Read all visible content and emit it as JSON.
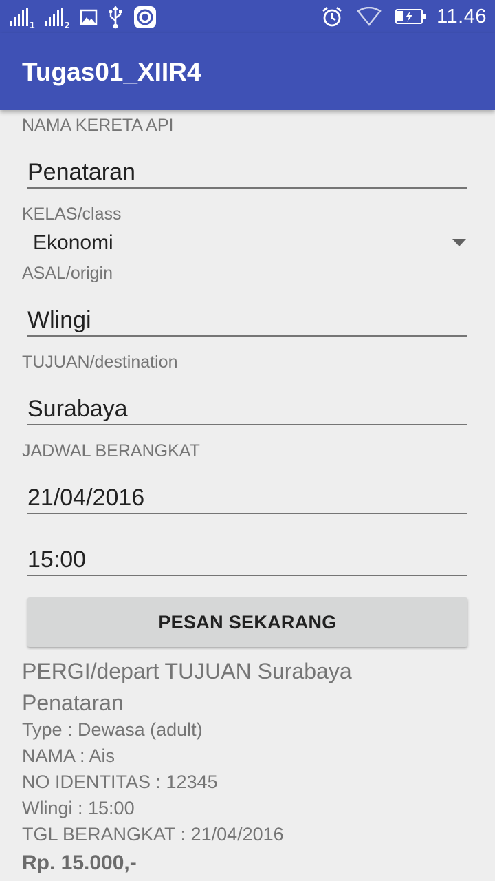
{
  "status_bar": {
    "sim1": "1",
    "sim2": "2",
    "time": "11.46",
    "icons": [
      "signal-icon",
      "image-icon",
      "usb-icon",
      "screen-record-icon",
      "alarm-icon",
      "wifi-icon",
      "battery-charging-icon"
    ]
  },
  "app": {
    "title": "Tugas01_XIIR4",
    "primary_color": "#3f51b5"
  },
  "form": {
    "train_name_label": "NAMA KERETA API",
    "train_name_value": "Penataran",
    "class_label": "KELAS/class",
    "class_value": "Ekonomi",
    "origin_label": "ASAL/origin",
    "origin_value": "Wlingi",
    "destination_label": "TUJUAN/destination",
    "destination_value": "Surabaya",
    "schedule_label": "JADWAL BERANGKAT",
    "date_value": "21/04/2016",
    "time_value": "15:00",
    "submit_label": "PESAN SEKARANG"
  },
  "result": {
    "line1": "PERGI/depart TUJUAN Surabaya",
    "line2": "Penataran",
    "line3": "Type : Dewasa (adult)",
    "line4": "NAMA : Ais",
    "line5": "NO IDENTITAS : 12345",
    "line6": "Wlingi : 15:00",
    "line7": "TGL BERANGKAT : 21/04/2016",
    "price": "Rp. 15.000,-"
  }
}
